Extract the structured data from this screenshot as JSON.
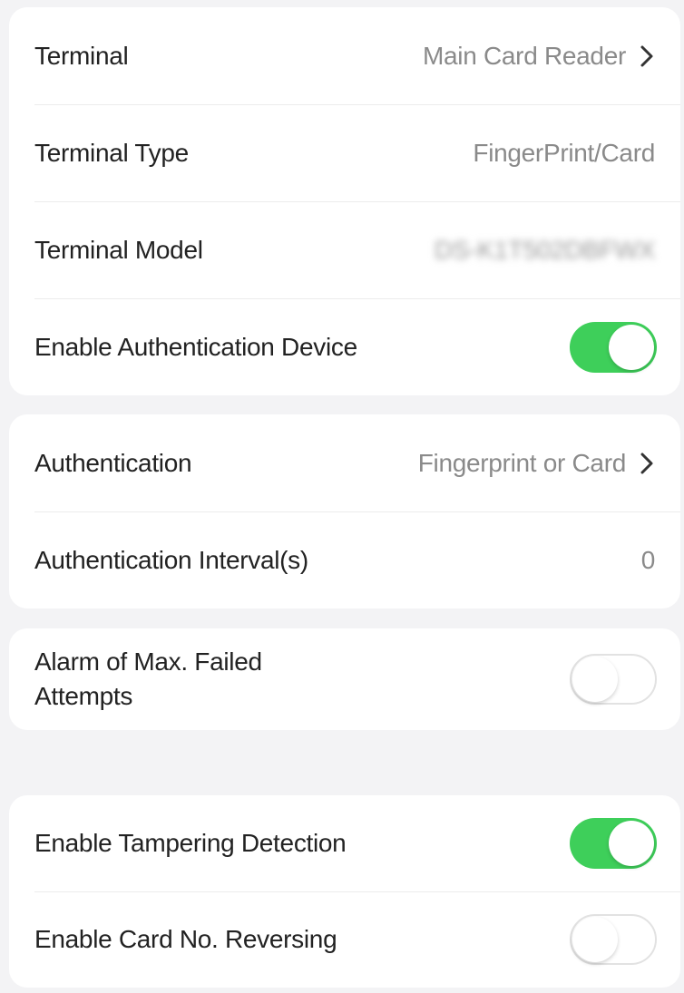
{
  "colors": {
    "page_background": "#f3f3f5",
    "card_background": "#ffffff",
    "toggle_on": "#3ecf5a",
    "toggle_off_border": "#e2e2e2",
    "label_text": "#222222",
    "value_text": "#8a8a8a"
  },
  "section1": {
    "terminal": {
      "label": "Terminal",
      "value": "Main Card Reader",
      "icon": "chevron-right-icon"
    },
    "terminal_type": {
      "label": "Terminal Type",
      "value": "FingerPrint/Card"
    },
    "terminal_model": {
      "label": "Terminal Model",
      "value": "DS-K1T502DBFWX"
    },
    "enable_auth_device": {
      "label": "Enable Authentication Device",
      "state": "on"
    }
  },
  "section2": {
    "authentication": {
      "label": "Authentication",
      "value": "Fingerprint or Card",
      "icon": "chevron-right-icon"
    },
    "auth_interval": {
      "label": "Authentication Interval(s)",
      "value": "0"
    }
  },
  "section3": {
    "alarm_failed": {
      "label": "Alarm of Max. Failed Attempts",
      "state": "off"
    }
  },
  "section4": {
    "tampering": {
      "label": "Enable Tampering Detection",
      "state": "on"
    },
    "card_reversing": {
      "label": "Enable Card No. Reversing",
      "state": "off"
    }
  }
}
